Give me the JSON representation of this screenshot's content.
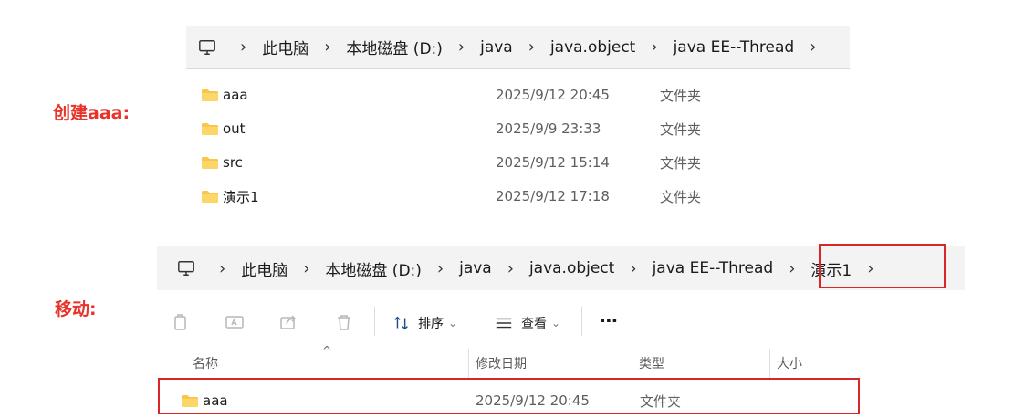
{
  "labels": {
    "create": "创建aaa:",
    "move": "移动:"
  },
  "bar1": {
    "crumbs": [
      "此电脑",
      "本地磁盘 (D:)",
      "java",
      "java.object",
      "java EE--Thread"
    ],
    "sep": "›"
  },
  "bar2": {
    "crumbs": [
      "此电脑",
      "本地磁盘 (D:)",
      "java",
      "java.object",
      "java EE--Thread",
      "演示1"
    ],
    "sep": "›"
  },
  "list1": {
    "rows": [
      {
        "name": "aaa",
        "date": "2025/9/12 20:45",
        "type": "文件夹"
      },
      {
        "name": "out",
        "date": "2025/9/9 23:33",
        "type": "文件夹"
      },
      {
        "name": "src",
        "date": "2025/9/12 15:14",
        "type": "文件夹"
      },
      {
        "name": "演示1",
        "date": "2025/9/12 17:18",
        "type": "文件夹"
      }
    ]
  },
  "toolbar": {
    "sort_label": "排序",
    "view_label": "查看",
    "more_label": "⋯",
    "caret": "⌄"
  },
  "columns": {
    "name": "名称",
    "modified": "修改日期",
    "type": "类型",
    "size": "大小",
    "sort_arrow": "^"
  },
  "list2": {
    "rows": [
      {
        "name": "aaa",
        "date": "2025/9/12 20:45",
        "type": "文件夹"
      }
    ]
  },
  "colors": {
    "annotation": "#e8332b",
    "highlight_box": "#d92626",
    "folder": "#f8c74a"
  }
}
